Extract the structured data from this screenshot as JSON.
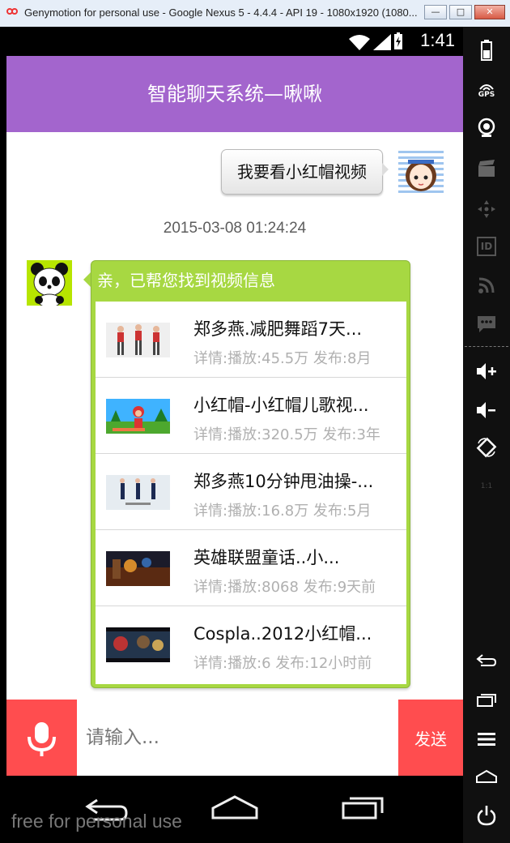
{
  "window": {
    "title": "Genymotion for personal use - Google Nexus 5 - 4.4.4 - API 19 - 1080x1920 (1080...",
    "minimize": "—",
    "maximize": "□",
    "close": "✕"
  },
  "status_bar": {
    "time": "1:41"
  },
  "app": {
    "title": "智能聊天系统—啾啾"
  },
  "chat": {
    "user_message": "我要看小红帽视频",
    "timestamp": "2015-03-08 01:24:24",
    "bot_message": "亲，已帮您找到视频信息",
    "videos": [
      {
        "title": "郑多燕.减肥舞蹈7天...",
        "info": "详情:播放:45.5万 发布:8月"
      },
      {
        "title": "小红帽-小红帽儿歌视...",
        "info": "详情:播放:320.5万 发布:3年"
      },
      {
        "title": "郑多燕10分钟甩油操-...",
        "info": "详情:播放:16.8万 发布:5月"
      },
      {
        "title": "英雄联盟童话..小...",
        "info": "详情:播放:8068 发布:9天前"
      },
      {
        "title": "Cospla..2012小红帽...",
        "info": "详情:播放:6 发布:12小时前"
      }
    ]
  },
  "input": {
    "placeholder": "请输入...",
    "send_label": "发送"
  },
  "nav": [
    "back-icon",
    "home-icon",
    "recent-apps-icon"
  ],
  "watermark": "free for personal use",
  "side_panel": {
    "icons": [
      "battery-icon",
      "gps-icon",
      "camera-icon",
      "clapperboard-icon",
      "dpad-icon",
      "id-icon",
      "cast-icon",
      "chat-icon",
      "volume-up-icon",
      "volume-down-icon",
      "rotate-icon",
      "scale-icon",
      "back-icon",
      "recent-apps-icon",
      "menu-icon",
      "home-icon",
      "power-icon"
    ],
    "gps_label": "GPS",
    "id_label": "ID",
    "scale_label": "1:1"
  },
  "colors": {
    "title_bar": "#a365cd",
    "bot_card": "#a7d842",
    "accent_red": "#ff4d4f"
  }
}
